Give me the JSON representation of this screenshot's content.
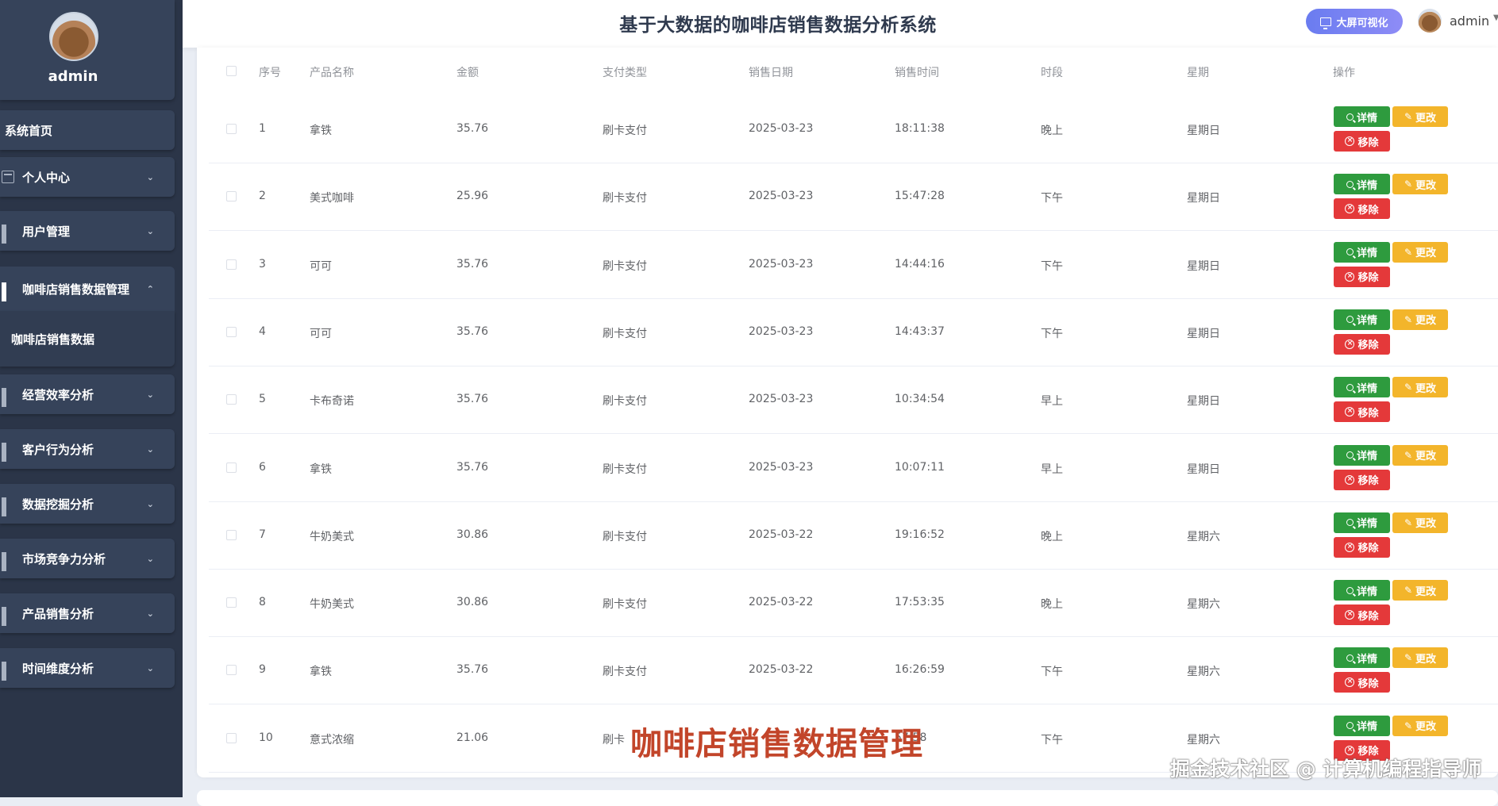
{
  "sidebar": {
    "username": "admin",
    "menu": [
      {
        "label": "系统首页",
        "icon": "none",
        "expandable": false
      },
      {
        "label": "个人中心",
        "icon": "card-icon",
        "expandable": true
      },
      {
        "label": "用户管理",
        "icon": "grid-icon",
        "expandable": true
      },
      {
        "label": "咖啡店销售数据管理",
        "icon": "grid-icon",
        "expandable": true,
        "expanded": true
      },
      {
        "label": "经营效率分析",
        "icon": "grid-icon",
        "expandable": true
      },
      {
        "label": "客户行为分析",
        "icon": "grid-icon",
        "expandable": true
      },
      {
        "label": "数据挖掘分析",
        "icon": "grid-icon",
        "expandable": true
      },
      {
        "label": "市场竞争力分析",
        "icon": "grid-icon",
        "expandable": true
      },
      {
        "label": "产品销售分析",
        "icon": "grid-icon",
        "expandable": true
      },
      {
        "label": "时间维度分析",
        "icon": "grid-icon",
        "expandable": true
      }
    ],
    "submenu_item": "咖啡店销售数据"
  },
  "header": {
    "title": "基于大数据的咖啡店销售数据分析系统",
    "bigscreen_label": "大屏可视化",
    "user": "admin"
  },
  "table": {
    "columns": [
      "序号",
      "产品名称",
      "金额",
      "支付类型",
      "销售日期",
      "销售时间",
      "时段",
      "星期",
      "操作"
    ],
    "rows": [
      {
        "no": "1",
        "product": "拿铁",
        "amount": "35.76",
        "pay": "刷卡支付",
        "date": "2025-03-23",
        "time": "18:11:38",
        "period": "晚上",
        "weekday": "星期日"
      },
      {
        "no": "2",
        "product": "美式咖啡",
        "amount": "25.96",
        "pay": "刷卡支付",
        "date": "2025-03-23",
        "time": "15:47:28",
        "period": "下午",
        "weekday": "星期日"
      },
      {
        "no": "3",
        "product": "可可",
        "amount": "35.76",
        "pay": "刷卡支付",
        "date": "2025-03-23",
        "time": "14:44:16",
        "period": "下午",
        "weekday": "星期日"
      },
      {
        "no": "4",
        "product": "可可",
        "amount": "35.76",
        "pay": "刷卡支付",
        "date": "2025-03-23",
        "time": "14:43:37",
        "period": "下午",
        "weekday": "星期日"
      },
      {
        "no": "5",
        "product": "卡布奇诺",
        "amount": "35.76",
        "pay": "刷卡支付",
        "date": "2025-03-23",
        "time": "10:34:54",
        "period": "早上",
        "weekday": "星期日"
      },
      {
        "no": "6",
        "product": "拿铁",
        "amount": "35.76",
        "pay": "刷卡支付",
        "date": "2025-03-23",
        "time": "10:07:11",
        "period": "早上",
        "weekday": "星期日"
      },
      {
        "no": "7",
        "product": "牛奶美式",
        "amount": "30.86",
        "pay": "刷卡支付",
        "date": "2025-03-22",
        "time": "19:16:52",
        "period": "晚上",
        "weekday": "星期六"
      },
      {
        "no": "8",
        "product": "牛奶美式",
        "amount": "30.86",
        "pay": "刷卡支付",
        "date": "2025-03-22",
        "time": "17:53:35",
        "period": "晚上",
        "weekday": "星期六"
      },
      {
        "no": "9",
        "product": "拿铁",
        "amount": "35.76",
        "pay": "刷卡支付",
        "date": "2025-03-22",
        "time": "16:26:59",
        "period": "下午",
        "weekday": "星期六"
      },
      {
        "no": "10",
        "product": "意式浓缩",
        "amount": "21.06",
        "pay": "刷卡",
        "date": "",
        "time": "57:58",
        "period": "下午",
        "weekday": "星期六"
      }
    ],
    "actions": {
      "detail": "详情",
      "edit": "更改",
      "remove": "移除"
    }
  },
  "overlay": {
    "caption": "咖啡店销售数据管理",
    "credit": "掘金技术社区 @ 计算机编程指导师"
  },
  "colors": {
    "sidebar_bg": "#2b3548",
    "detail_btn": "#2e9b3e",
    "edit_btn": "#f3b52b",
    "remove_btn": "#e4393a",
    "bigscreen_btn": "#7b84f3",
    "caption": "#c2452a"
  }
}
